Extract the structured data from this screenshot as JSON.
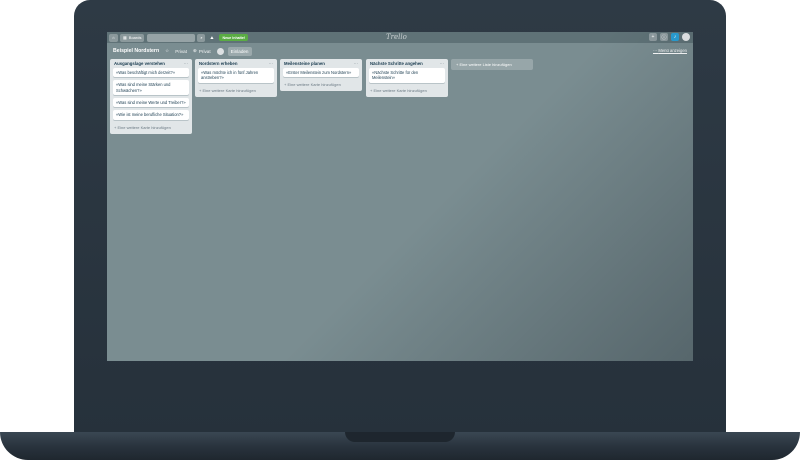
{
  "header": {
    "home_icon": "home-icon",
    "boards_label": "Boards",
    "search_placeholder": "",
    "logo_text": "Trello",
    "new_button": "Neue Inhalte!",
    "right_icons": [
      "plus-icon",
      "info-icon",
      "bell-icon"
    ]
  },
  "board": {
    "title": "Beispiel Nordstern",
    "visibility_1": "Privat",
    "visibility_2": "Privat",
    "invite_label": "Einladen",
    "menu_label": "Menü anzeigen"
  },
  "lists": [
    {
      "title": "Ausgangslage verstehen",
      "cards": [
        "«Was beschäftigt mich derzeit?»",
        "«Was sind meine Stärken und Schwächen?»",
        "«Was sind meine Werte und Treiber?»",
        "«Wie ist meine berufliche Situation?»"
      ],
      "add_card": "+ Eine weitere Karte hinzufügen"
    },
    {
      "title": "Nordstern erheben",
      "cards": [
        "«Was möchte ich in fünf Jahren anstreben?»"
      ],
      "add_card": "+ Eine weitere Karte hinzufügen"
    },
    {
      "title": "Meilensteine planen",
      "cards": [
        "«Erster Meilenstein zum Nordstern»"
      ],
      "add_card": "+ Eine weitere Karte hinzufügen"
    },
    {
      "title": "Nächste Schritte angehen",
      "cards": [
        "«Nächste Schritte für den Meilenstein»"
      ],
      "add_card": "+ Eine weitere Karte hinzufügen"
    }
  ],
  "add_list": "+ Eine weitere Liste hinzufügen",
  "list_menu": "···"
}
